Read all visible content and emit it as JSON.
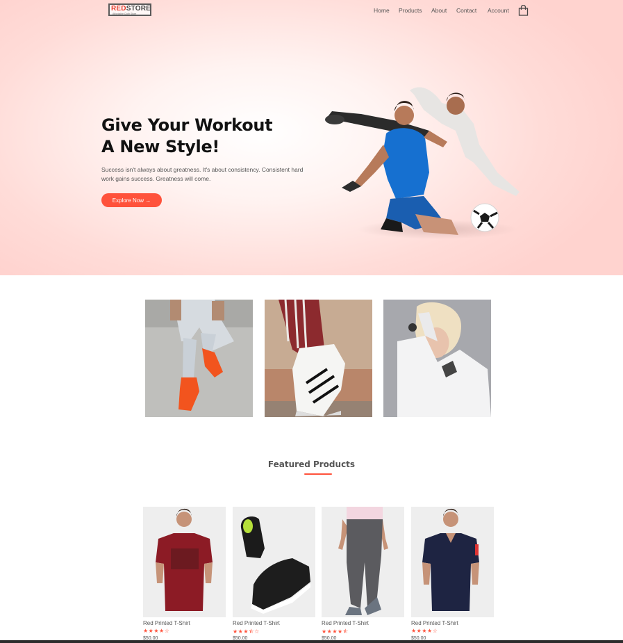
{
  "brand": {
    "logo_red": "RED",
    "logo_dark": "STORE",
    "tagline": "Affordable Cloth Store",
    "accent_color": "#ff523b"
  },
  "nav": {
    "items": [
      {
        "label": "Home"
      },
      {
        "label": "Products"
      },
      {
        "label": "About"
      },
      {
        "label": "Contact"
      },
      {
        "label": "Account"
      }
    ],
    "cart_icon": "shopping-bag-icon"
  },
  "hero": {
    "title_line1": "Give Your Workout",
    "title_line2": "A New Style!",
    "subtitle": "Success isn't always about greatness. It's about consistency. Consistent hard work gains success. Greatness will come.",
    "button_label": "Explore Now →",
    "image": "football-players-image"
  },
  "categories": [
    {
      "image": "sneakers-on-legs-image"
    },
    {
      "image": "striped-track-pants-shoe-image"
    },
    {
      "image": "woman-white-hoodie-image"
    }
  ],
  "featured": {
    "title": "Featured Products",
    "products": [
      {
        "name": "Red Printed T-Shirt",
        "rating": "★★★★☆",
        "price": "$50.00",
        "image": "maroon-tshirt-image"
      },
      {
        "name": "Red Printed T-Shirt",
        "rating": "★★★⯪☆",
        "price": "$50.00",
        "image": "black-sneakers-image"
      },
      {
        "name": "Red Printed T-Shirt",
        "rating": "★★★★⯪",
        "price": "$50.00",
        "image": "grey-joggers-image"
      },
      {
        "name": "Red Printed T-Shirt",
        "rating": "★★★★☆",
        "price": "$50.00",
        "image": "navy-polo-image"
      }
    ]
  }
}
